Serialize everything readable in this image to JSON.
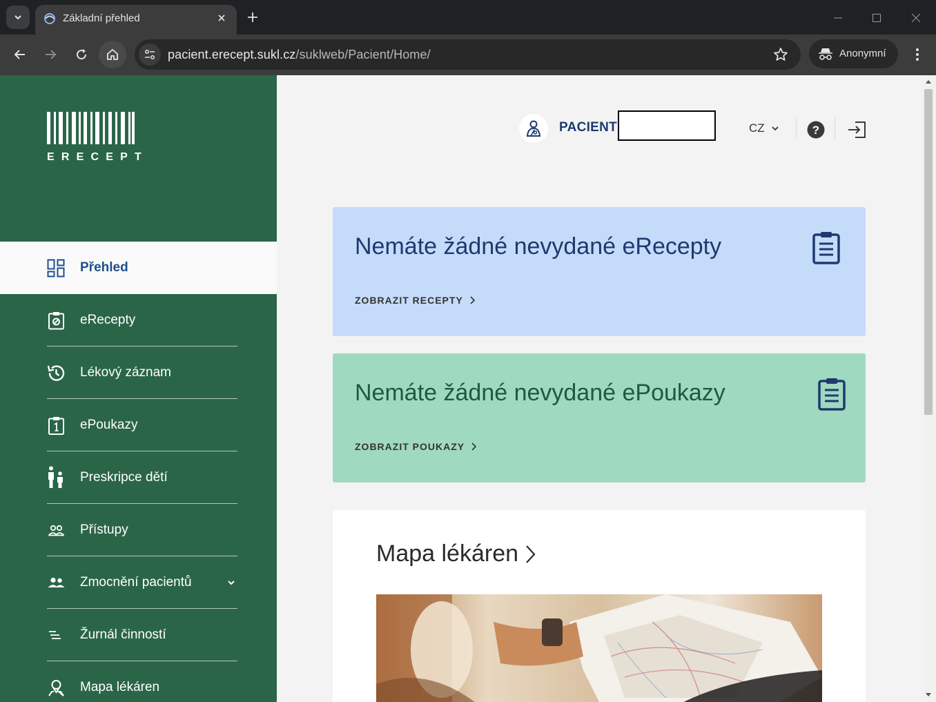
{
  "browser": {
    "tab_title": "Základní přehled",
    "url_host": "pacient.erecept.sukl.cz",
    "url_path": "/suklweb/Pacient/Home/",
    "profile_label": "Anonymní"
  },
  "logo": {
    "text": "ERECEPT"
  },
  "sidebar": {
    "items": [
      {
        "label": "Přehled",
        "icon": "dashboard-icon",
        "active": true
      },
      {
        "label": "eRecepty",
        "icon": "prescription-icon"
      },
      {
        "label": "Lékový záznam",
        "icon": "history-icon"
      },
      {
        "label": "ePoukazy",
        "icon": "voucher-icon"
      },
      {
        "label": "Preskripce dětí",
        "icon": "family-icon"
      },
      {
        "label": "Přístupy",
        "icon": "people-icon"
      },
      {
        "label": "Zmocnění pacientů",
        "icon": "group-icon",
        "expandable": true
      },
      {
        "label": "Žurnál činností",
        "icon": "list-icon"
      },
      {
        "label": "Mapa lékáren",
        "icon": "map-pin-icon"
      }
    ]
  },
  "header": {
    "user_role": "PACIENT",
    "user_name": "",
    "language": "CZ"
  },
  "cards": {
    "recepty": {
      "title": "Nemáte žádné nevydané eRecepty",
      "link": "ZOBRAZIT RECEPTY"
    },
    "poukazy": {
      "title": "Nemáte žádné nevydané ePoukazy",
      "link": "ZOBRAZIT POUKAZY"
    }
  },
  "map": {
    "title": "Mapa lékáren"
  },
  "colors": {
    "sidebar": "#2b6548",
    "card_blue": "#c5dbfa",
    "card_green": "#9fd9bf",
    "accent_blue": "#1e3a6e"
  }
}
